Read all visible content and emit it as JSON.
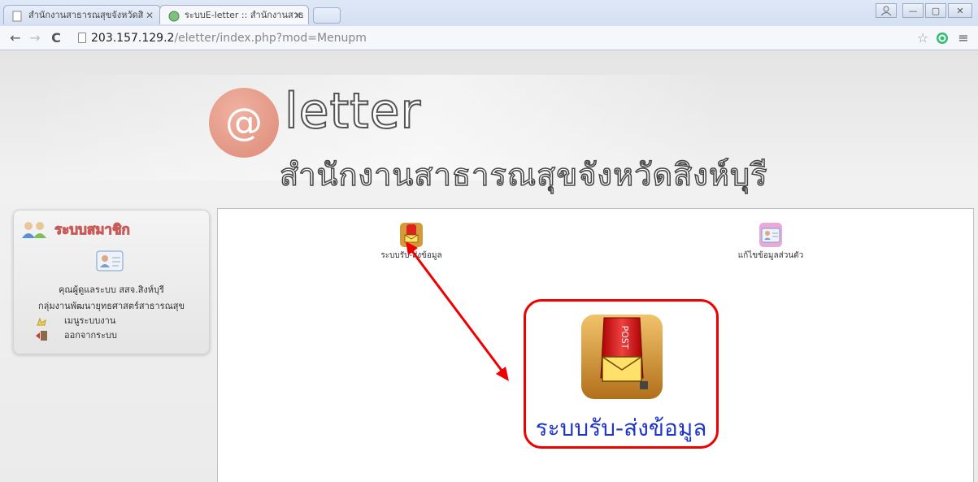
{
  "browser": {
    "tabs": [
      {
        "title": "สำนักงานสาธารณสุขจังหวัดสิ",
        "active": false
      },
      {
        "title": "ระบบE-letter :: สำนักงานสาธ",
        "active": true
      }
    ],
    "url_host": "203.157.129.2",
    "url_path": "/eletter/index.php?mod=Menupm",
    "window_controls": {
      "minimize": "—",
      "maximize": "▢",
      "close": "✕"
    }
  },
  "banner": {
    "at_symbol": "@",
    "logo_word": "letter",
    "subtitle": "สำนักงานสาธารณสุขจังหวัดสิงห์บุรี"
  },
  "sidebar": {
    "title": "ระบบสมาชิก",
    "user": "คุณผู้ดูแลระบบ สสจ.สิงห์บุรี",
    "group": "กลุ่มงานพัฒนายุทธศาสตร์สาธารณสุข",
    "menu": [
      {
        "label": "เมนูระบบงาน",
        "icon": "hand-pointer-icon"
      },
      {
        "label": "ออกจากระบบ",
        "icon": "logout-door-icon"
      }
    ]
  },
  "content": {
    "tiles": [
      {
        "label": "ระบบรับ-ส่งข้อมูล",
        "icon": "mailbox-icon"
      },
      {
        "label": "แก้ไขข้อมูลส่วนตัว",
        "icon": "id-card-icon"
      }
    ],
    "callout": {
      "label": "ระบบรับ-ส่งข้อมูล",
      "icon": "mailbox-icon",
      "post_text": "POST"
    }
  },
  "colors": {
    "callout_border": "#e00000",
    "arrow": "#e00000",
    "callout_text": "#1d35c8",
    "at_circle": "#dc8a76"
  }
}
